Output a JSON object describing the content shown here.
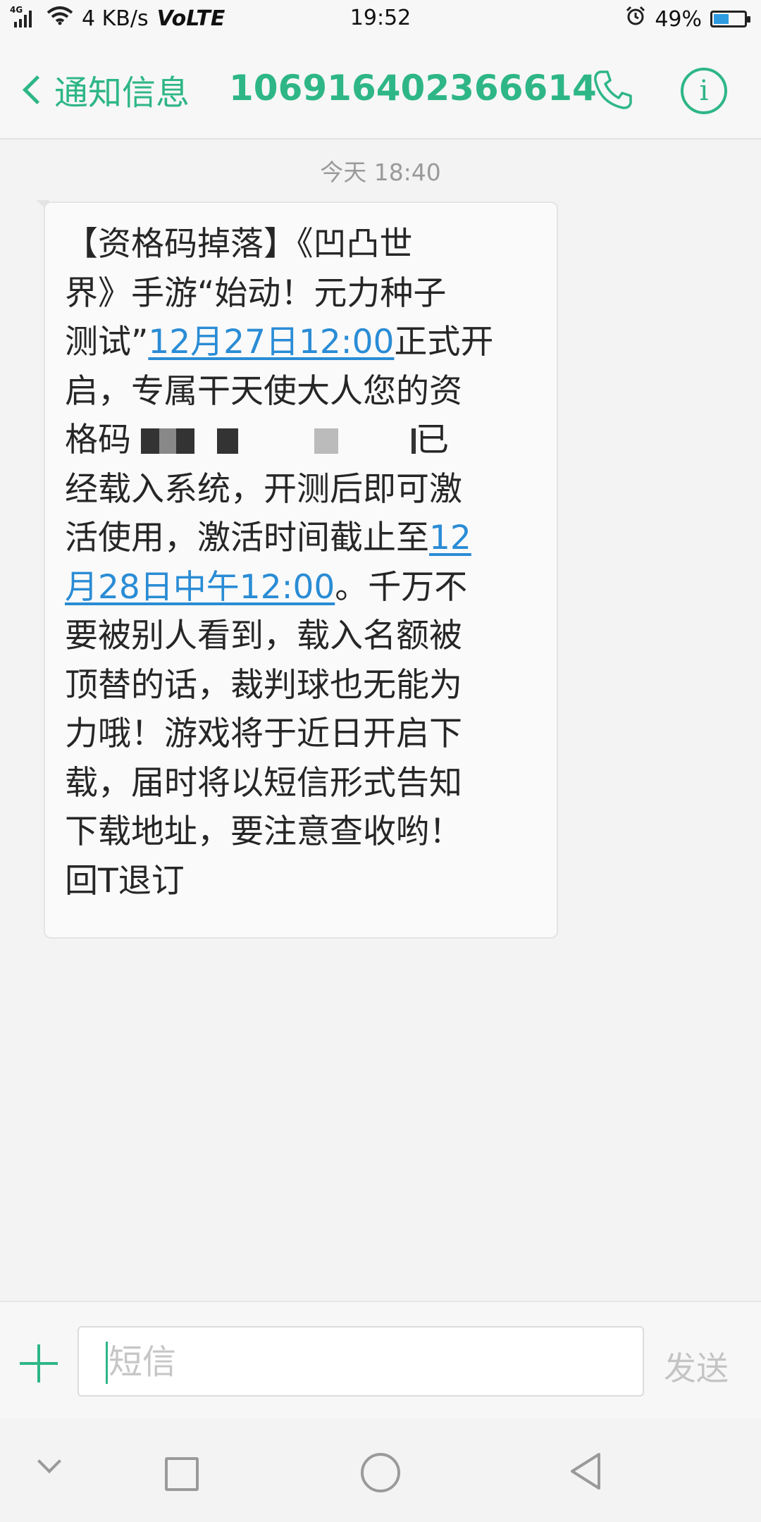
{
  "status_bar": {
    "network_type": "4G",
    "speed": "4 KB/s",
    "volte": "VoLTE",
    "time": "19:52",
    "battery_percent": "49%",
    "battery_level": 0.49
  },
  "header": {
    "back_label": "通知信息",
    "sender_number": "106916402366614"
  },
  "conversation": {
    "timestamp": "今天 18:40",
    "message": {
      "line1": "【资格码掉落】《凹凸世",
      "line2": "界》手游“始动！元力种子",
      "line3_prefix": "测试”",
      "line3_link": "12月27日12:00",
      "line3_suffix": "正式开",
      "line4": "启，专属干天使大人您的资",
      "line5_prefix": "格码",
      "line5_suffix": "已",
      "line6": "经载入系统，开测后即可激",
      "line7_prefix": "活使用，激活时间截止至",
      "line7_link": "12",
      "line8_link": "月28日中午12:00",
      "line8_suffix": "。千万不",
      "line9": "要被别人看到，载入名额被",
      "line10": "顶替的话，裁判球也无能为",
      "line11": "力哦！游戏将于近日开启下",
      "line12": "载，届时将以短信形式告知",
      "line13": "下载地址，要注意查收哟！",
      "line14": "回T退订"
    }
  },
  "compose": {
    "placeholder": "短信",
    "send_label": "发送"
  },
  "colors": {
    "accent": "#2eb686",
    "link": "#2a8cd5",
    "timestamp": "#9a9a9a"
  }
}
